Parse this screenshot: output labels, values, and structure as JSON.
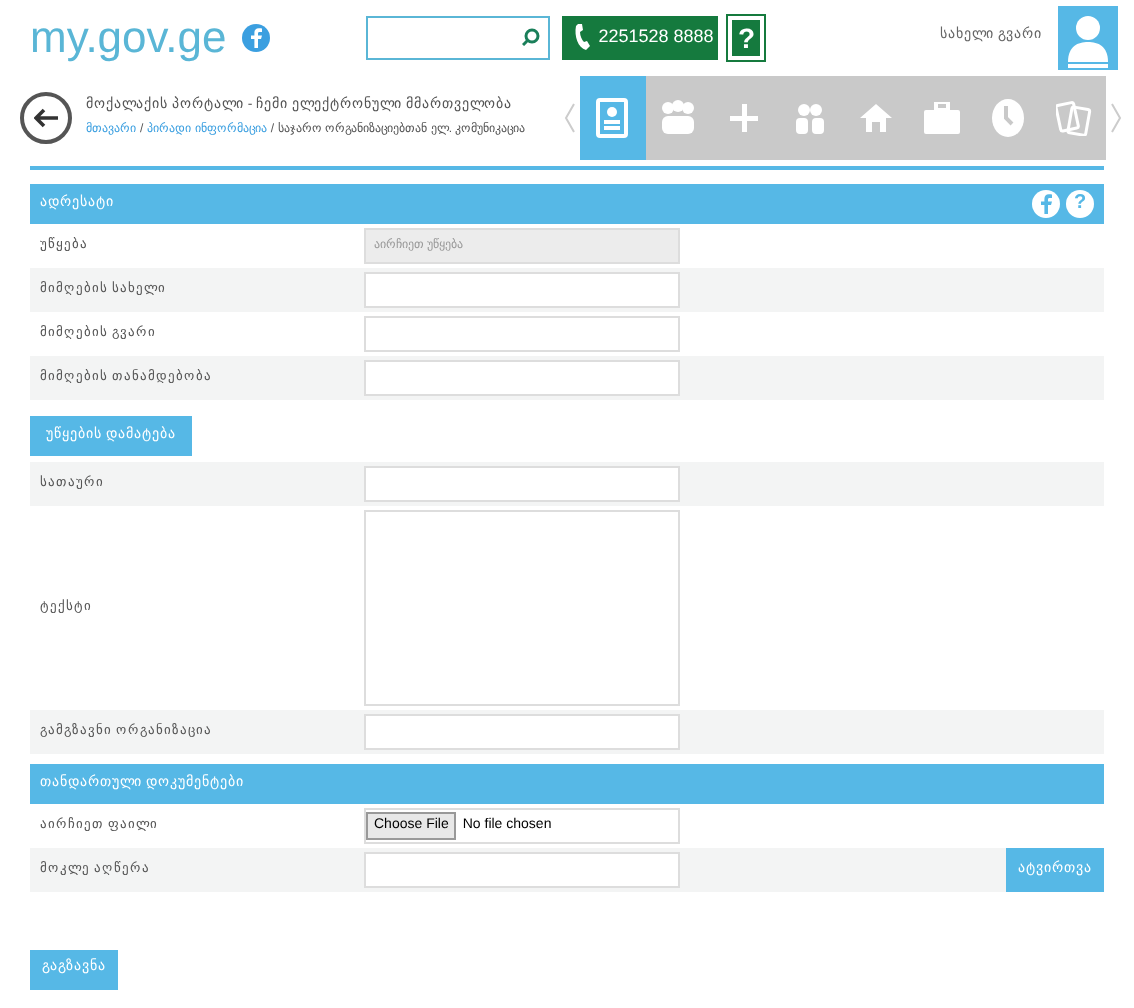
{
  "header": {
    "logo": "my.gov.ge",
    "phone": "2251528 8888",
    "help": "?",
    "user_name": "სახელი გვარი"
  },
  "page": {
    "title": "მოქალაქის პორტალი - ჩემი ელექტრონული მმართველობა",
    "breadcrumb_separators": [
      "/",
      "/"
    ],
    "breadcrumbs": [
      {
        "label": "მთავარი",
        "link": true
      },
      {
        "label": "პირადი ინფორმაცია",
        "link": true
      },
      {
        "label": "საჯარო ორგანიზაციებთან ელ. კომუნიკაცია",
        "link": false
      }
    ]
  },
  "nav_tabs": [
    {
      "selected": true
    },
    {
      "selected": false
    },
    {
      "selected": false
    },
    {
      "selected": false
    },
    {
      "selected": false
    },
    {
      "selected": false
    },
    {
      "selected": false
    },
    {
      "selected": false
    }
  ],
  "sections": [
    {
      "title": "ადრესატი",
      "help_icons": true,
      "rows": [
        {
          "kind": "select",
          "label": "უწყება",
          "placeholder": "აირჩიეთ უწყება",
          "disabled": true
        },
        {
          "kind": "input",
          "label": "მიმღების სახელი"
        },
        {
          "kind": "input",
          "label": "მიმღების გვარი"
        },
        {
          "kind": "input",
          "label": "მიმღების თანამდებობა"
        },
        {
          "kind": "button",
          "label": "უწყების დამატება"
        },
        {
          "kind": "input",
          "label": "სათაური"
        },
        {
          "kind": "textarea",
          "label": "ტექსტი"
        },
        {
          "kind": "input",
          "label": "გამგზავნი ორგანიზაცია"
        }
      ]
    },
    {
      "title": "თანდართული დოკუმენტები",
      "help_icons": false,
      "rows": [
        {
          "kind": "file",
          "label": "აირჩიეთ ფაილი",
          "button": "Choose File",
          "status": "No file chosen"
        },
        {
          "kind": "input",
          "label": "მოკლე აღწერა",
          "action": "ატვირთვა"
        }
      ]
    }
  ],
  "submit": "გაგზავნა"
}
